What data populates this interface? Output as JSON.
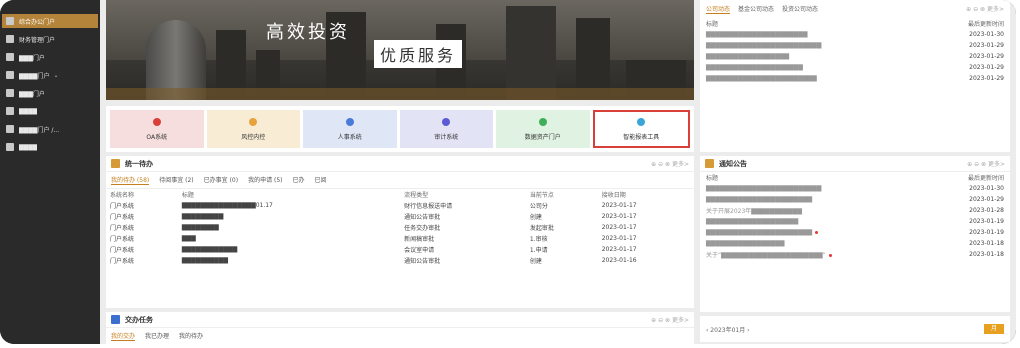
{
  "sidebar": {
    "items": [
      {
        "label": "综合办公门户",
        "active": true,
        "arrow": ""
      },
      {
        "label": "财务管理门户",
        "active": false,
        "arrow": ""
      },
      {
        "label": "▇▇▇门户",
        "active": false,
        "arrow": ""
      },
      {
        "label": "▇▇▇▇门户",
        "active": false,
        "arrow": "⌄"
      },
      {
        "label": "▇▇▇门户",
        "active": false,
        "arrow": ""
      },
      {
        "label": "▇▇▇▇",
        "active": false,
        "arrow": ""
      },
      {
        "label": "▇▇▇▇门户 /...",
        "active": false,
        "arrow": ""
      },
      {
        "label": "▇▇▇▇",
        "active": false,
        "arrow": ""
      }
    ]
  },
  "banner": {
    "line1": "高效投资",
    "line2": "优质服务"
  },
  "tiles": [
    {
      "label": "OA系统",
      "bg": "#f7dede",
      "dot": "#d9403a",
      "selected": false
    },
    {
      "label": "风控内控",
      "bg": "#f8ecd5",
      "dot": "#e6a23c",
      "selected": false
    },
    {
      "label": "人事系统",
      "bg": "#dfe7f7",
      "dot": "#4a7bd8",
      "selected": false
    },
    {
      "label": "审计系统",
      "bg": "#e3e3f6",
      "dot": "#5b5bd6",
      "selected": false
    },
    {
      "label": "数据资产门户",
      "bg": "#e0f2e2",
      "dot": "#3fae5a",
      "selected": false
    },
    {
      "label": "智能报表工具",
      "bg": "#ffffff",
      "dot": "#3aa6d8",
      "selected": true
    }
  ],
  "todo": {
    "title": "统一待办",
    "more": "⊕ ⊖ ⊗ 更多>",
    "tabs": [
      "我的待办 (58)",
      "待阅事宜 (2)",
      "已办事宜 (0)",
      "我的申请 (5)",
      "已办",
      "已阅"
    ],
    "headers": [
      "系统名称",
      "标题",
      "流程类型",
      "当前节点",
      "接收日期"
    ],
    "rows": [
      [
        "门户系统",
        "▇▇▇▇▇▇▇▇▇▇▇▇▇▇▇▇01.17",
        "财行信息报送申请",
        "公司分",
        "2023-01-17"
      ],
      [
        "门户系统",
        "▇▇▇▇▇▇▇▇▇",
        "通知公告审批",
        "创建",
        "2023-01-17"
      ],
      [
        "门户系统",
        "▇▇▇▇▇▇▇▇",
        "任务交办审批",
        "发起审批",
        "2023-01-17"
      ],
      [
        "门户系统",
        "▇▇▇",
        "新闻稿审批",
        "1.审核",
        "2023-01-17"
      ],
      [
        "门户系统",
        "▇▇▇▇▇▇▇▇▇▇▇▇",
        "会议室申请",
        "1.申请",
        "2023-01-17"
      ],
      [
        "门户系统",
        "▇▇▇▇▇▇▇▇▇▇",
        "通知公告审批",
        "创建",
        "2023-01-16"
      ]
    ]
  },
  "tasks": {
    "title": "交办任务",
    "more": "⊕ ⊖ ⊗ 更多>",
    "tabs": [
      "我的交办",
      "我已办理",
      "我的待办"
    ]
  },
  "news": {
    "tabs": [
      "公司动态",
      "基金公司动态",
      "投资公司动态"
    ],
    "more": "⊕ ⊖ ⊗ 更多>",
    "header_left": "标题",
    "header_right": "最后更新时间",
    "rows": [
      {
        "title": "▇▇▇▇▇▇▇▇▇▇▇▇▇▇▇▇▇▇▇▇▇▇",
        "date": "2023-01-30"
      },
      {
        "title": "▇▇▇▇▇▇▇▇▇▇▇▇▇▇▇▇▇▇▇▇▇▇▇▇▇",
        "date": "2023-01-29"
      },
      {
        "title": "▇▇▇▇▇▇▇▇▇▇▇▇▇▇▇▇▇▇",
        "date": "2023-01-29"
      },
      {
        "title": "▇▇▇▇▇▇▇▇▇▇▇▇▇▇▇▇▇▇▇▇▇",
        "date": "2023-01-29"
      },
      {
        "title": "▇▇▇▇▇▇▇▇▇▇▇▇▇▇▇▇▇▇▇▇▇▇▇▇",
        "date": "2023-01-29"
      }
    ]
  },
  "notice": {
    "title": "通知公告",
    "more": "⊕ ⊖ ⊗ 更多>",
    "header_left": "标题",
    "header_right": "最后更新时间",
    "rows": [
      {
        "title": "▇▇▇▇▇▇▇▇▇▇▇▇▇▇▇▇▇▇▇▇▇▇▇▇▇",
        "date": "2023-01-30",
        "dot": false
      },
      {
        "title": "▇▇▇▇▇▇▇▇▇▇▇▇▇▇▇▇▇▇▇▇▇▇▇",
        "date": "2023-01-29",
        "dot": false
      },
      {
        "title": "关于开展2023年▇▇▇▇▇▇▇▇▇▇▇",
        "date": "2023-01-28",
        "dot": false
      },
      {
        "title": "▇▇▇▇▇▇▇▇▇▇▇▇▇▇▇▇▇▇▇▇",
        "date": "2023-01-19",
        "dot": false
      },
      {
        "title": "▇▇▇▇▇▇▇▇▇▇▇▇▇▇▇▇▇▇▇▇▇▇▇",
        "date": "2023-01-19",
        "dot": true
      },
      {
        "title": "▇▇▇▇▇▇▇▇▇▇▇▇▇▇▇▇▇",
        "date": "2023-01-18",
        "dot": false
      },
      {
        "title": "关于“▇▇▇▇▇▇▇▇▇▇▇▇▇▇▇▇▇▇▇▇▇▇”",
        "date": "2023-01-18",
        "dot": true
      }
    ]
  },
  "calendar": {
    "month": "‹  2023年01月  ›",
    "button": "月"
  }
}
